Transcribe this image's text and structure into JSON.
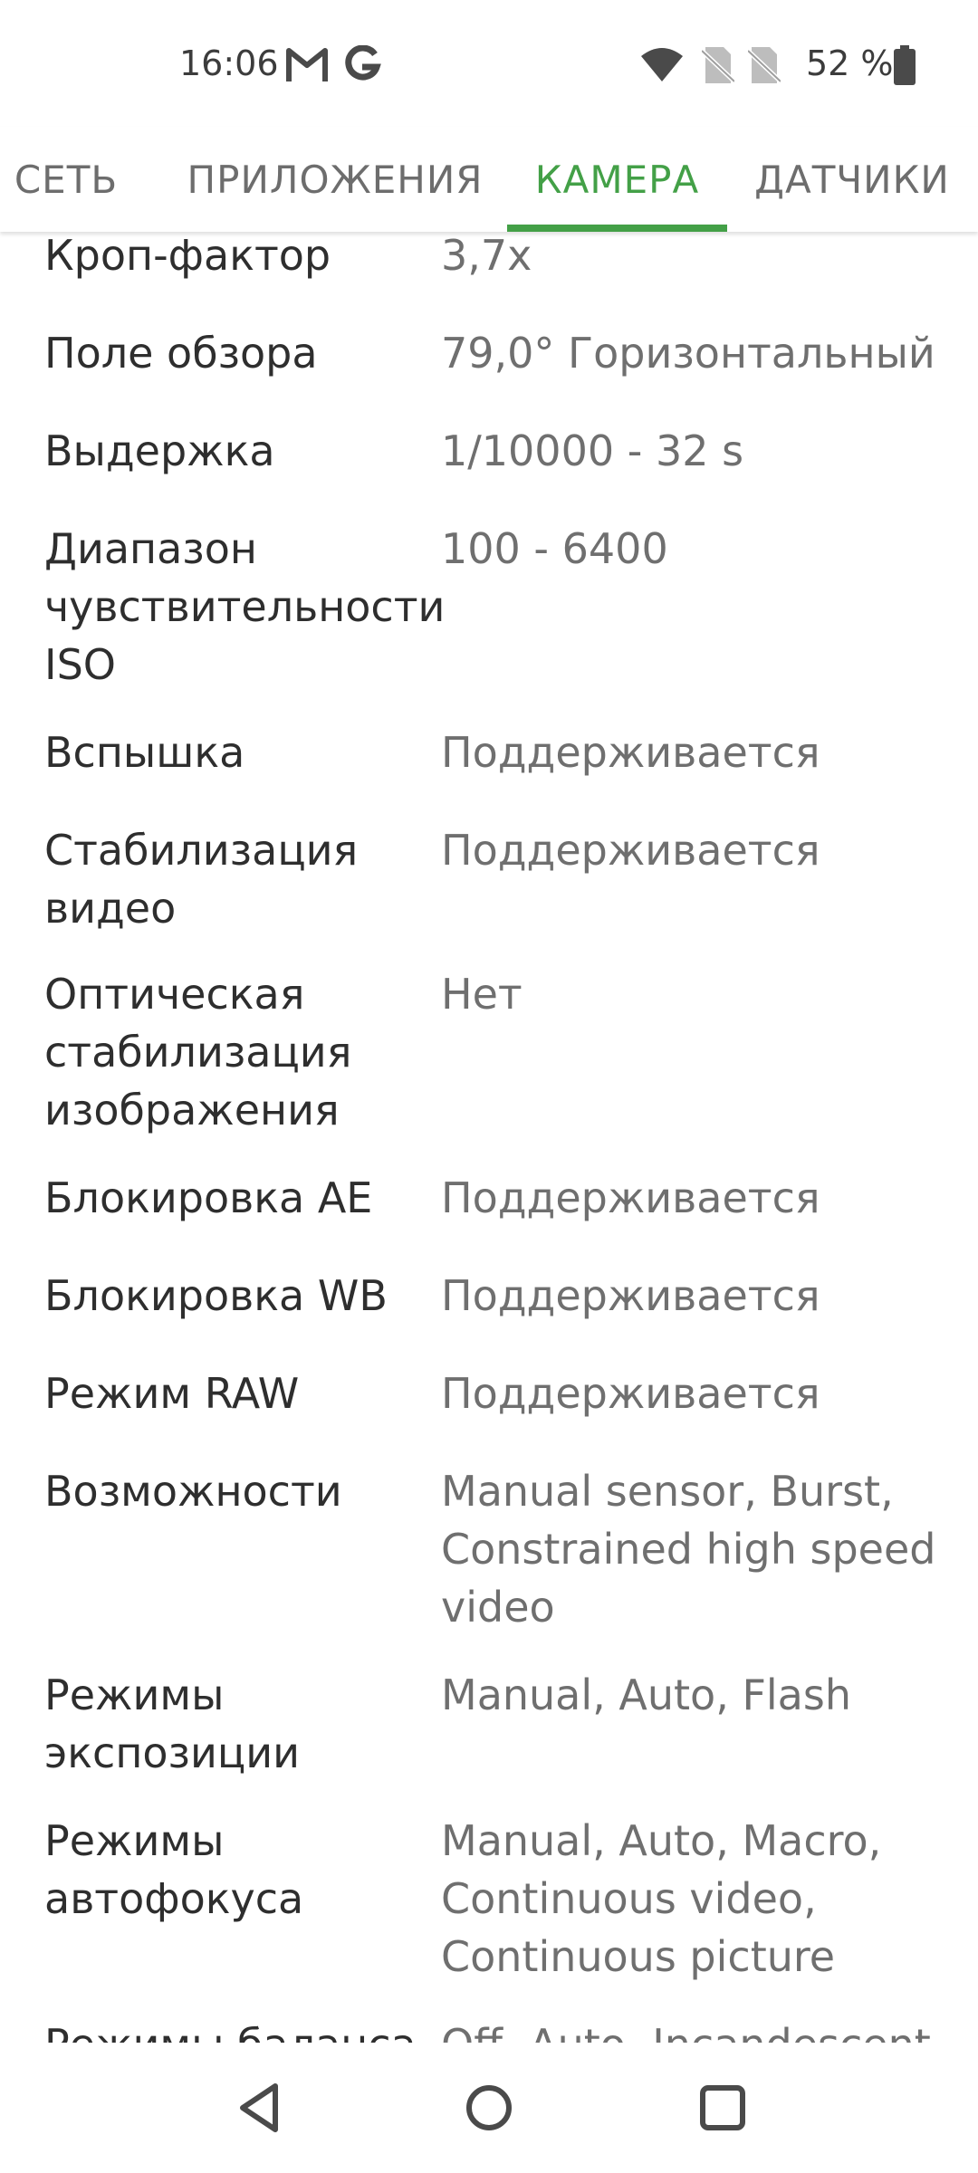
{
  "status_bar": {
    "time": "16:06",
    "battery": "52 %",
    "icons": [
      "gmail-icon",
      "google-icon",
      "wifi-icon",
      "no-sim-icon",
      "no-sim-icon",
      "battery-icon"
    ]
  },
  "tabs": [
    {
      "label": "СЕТЬ"
    },
    {
      "label": "ПРИЛОЖЕНИЯ"
    },
    {
      "label": "КАМЕРА"
    },
    {
      "label": "ДАТЧИКИ"
    }
  ],
  "accent_color": "#43a047",
  "rows": [
    {
      "label": "Кроп-фактор",
      "value": "3,7x"
    },
    {
      "label": "Поле обзора",
      "value": "79,0° Горизонтальный"
    },
    {
      "label": "Выдержка",
      "value": "1/10000 - 32 s"
    },
    {
      "label": "Диапазон чувствительности ISO",
      "value": "100 - 6400"
    },
    {
      "label": "Вспышка",
      "value": "Поддерживается"
    },
    {
      "label": "Стабилизация видео",
      "value": "Поддерживается"
    },
    {
      "label": "Оптическая стабилизация изображения",
      "value": "Нет"
    },
    {
      "label": "Блокировка AE",
      "value": "Поддерживается"
    },
    {
      "label": "Блокировка WB",
      "value": "Поддерживается"
    },
    {
      "label": "Режим RAW",
      "value": "Поддерживается"
    },
    {
      "label": "Возможности",
      "value": "Manual sensor, Burst, Constrained high speed video"
    },
    {
      "label": "Режимы экспозиции",
      "value": "Manual, Auto, Flash"
    },
    {
      "label": "Режимы автофокуса",
      "value": "Manual, Auto, Macro, Continuous video, Continuous picture"
    },
    {
      "label": "Режимы баланса",
      "value": "Off, Auto, Incandescent"
    }
  ],
  "nav": [
    "back-icon",
    "home-icon",
    "recents-icon"
  ]
}
